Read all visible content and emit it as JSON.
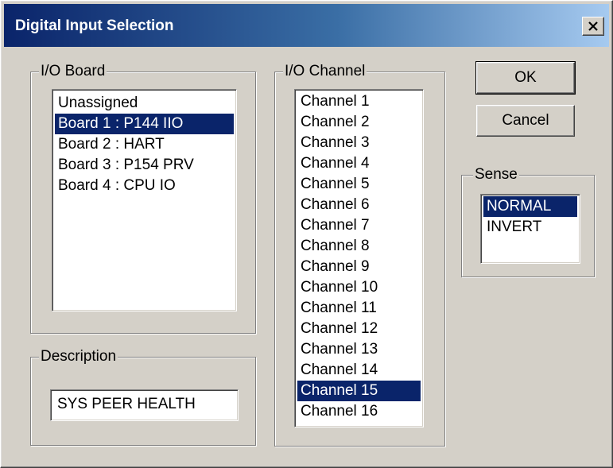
{
  "window": {
    "title": "Digital Input Selection"
  },
  "io_board": {
    "label": "I/O Board",
    "items": [
      {
        "label": "Unassigned",
        "selected": false
      },
      {
        "label": "Board 1 : P144 IIO",
        "selected": true
      },
      {
        "label": "Board 2 : HART",
        "selected": false
      },
      {
        "label": "Board 3 : P154 PRV",
        "selected": false
      },
      {
        "label": "Board 4 : CPU IO",
        "selected": false
      }
    ]
  },
  "io_channel": {
    "label": "I/O Channel",
    "items": [
      {
        "label": "Channel 1",
        "selected": false
      },
      {
        "label": "Channel 2",
        "selected": false
      },
      {
        "label": "Channel 3",
        "selected": false
      },
      {
        "label": "Channel 4",
        "selected": false
      },
      {
        "label": "Channel 5",
        "selected": false
      },
      {
        "label": "Channel 6",
        "selected": false
      },
      {
        "label": "Channel 7",
        "selected": false
      },
      {
        "label": "Channel 8",
        "selected": false
      },
      {
        "label": "Channel 9",
        "selected": false
      },
      {
        "label": "Channel 10",
        "selected": false
      },
      {
        "label": "Channel 11",
        "selected": false
      },
      {
        "label": "Channel 12",
        "selected": false
      },
      {
        "label": "Channel 13",
        "selected": false
      },
      {
        "label": "Channel 14",
        "selected": false
      },
      {
        "label": "Channel 15",
        "selected": true
      },
      {
        "label": "Channel 16",
        "selected": false
      }
    ]
  },
  "description": {
    "label": "Description",
    "value": "SYS PEER HEALTH"
  },
  "sense": {
    "label": "Sense",
    "items": [
      {
        "label": "NORMAL",
        "selected": true
      },
      {
        "label": "INVERT",
        "selected": false
      }
    ]
  },
  "buttons": {
    "ok": "OK",
    "cancel": "Cancel"
  },
  "icons": {
    "close": "close-icon"
  },
  "colors": {
    "selection": "#0a246a",
    "titlebar_start": "#0a246a",
    "titlebar_end": "#a6caf0",
    "face": "#d4d0c8"
  }
}
